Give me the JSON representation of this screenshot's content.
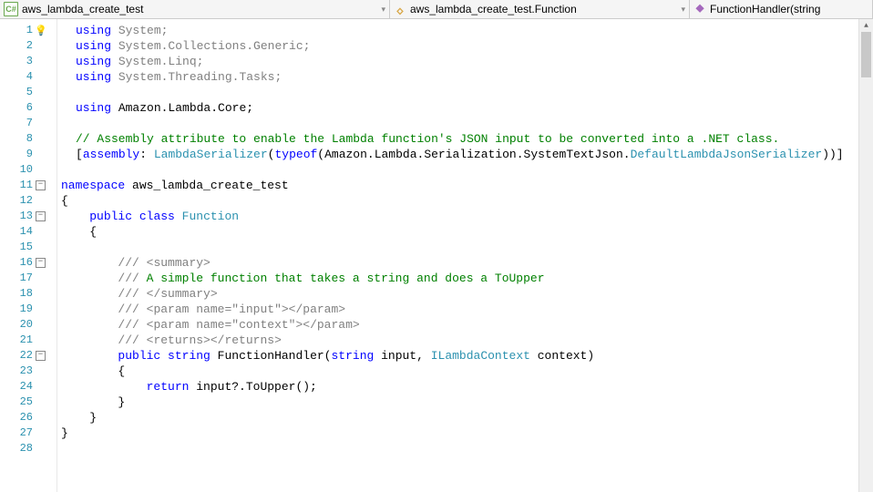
{
  "nav": {
    "crumb1": {
      "icon": "C#",
      "label": "aws_lambda_create_test"
    },
    "crumb2": {
      "label": "aws_lambda_create_test.Function"
    },
    "crumb3": {
      "label": "FunctionHandler(string"
    }
  },
  "lines": {
    "nums": [
      "1",
      "2",
      "3",
      "4",
      "5",
      "6",
      "7",
      "8",
      "9",
      "10",
      "11",
      "12",
      "13",
      "14",
      "15",
      "16",
      "17",
      "18",
      "19",
      "20",
      "21",
      "22",
      "23",
      "24",
      "25",
      "26",
      "27",
      "28"
    ]
  },
  "code": {
    "l1": {
      "a": "using",
      "b": " System;"
    },
    "l2": {
      "a": "using",
      "b": " System.Collections.Generic;"
    },
    "l3": {
      "a": "using",
      "b": " System.Linq;"
    },
    "l4": {
      "a": "using",
      "b": " System.Threading.Tasks;"
    },
    "l5": "",
    "l6": {
      "a": "using",
      "b": " Amazon.Lambda.Core;"
    },
    "l7": "",
    "l8": "// Assembly attribute to enable the Lambda function's JSON input to be converted into a .NET class.",
    "l9": {
      "a": "[",
      "b": "assembly",
      "c": ": ",
      "d": "LambdaSerializer",
      "e": "(",
      "f": "typeof",
      "g": "(Amazon.Lambda.Serialization.SystemTextJson.",
      "h": "DefaultLambdaJsonSerializer",
      "i": "))]"
    },
    "l10": "",
    "l11": {
      "a": "namespace",
      "b": " aws_lambda_create_test"
    },
    "l12": "{",
    "l13": {
      "a": "    ",
      "b": "public",
      "c": " ",
      "d": "class",
      "e": " ",
      "f": "Function"
    },
    "l14": "    {",
    "l15": "",
    "l16": {
      "a": "        ",
      "b": "/// ",
      "c": "<summary>"
    },
    "l17": {
      "a": "        ",
      "b": "/// ",
      "c": "A simple function that takes a string and does a ToUpper"
    },
    "l18": {
      "a": "        ",
      "b": "/// ",
      "c": "</summary>"
    },
    "l19": {
      "a": "        ",
      "b": "/// ",
      "c": "<param name=\"",
      "d": "input",
      "e": "\"></param>"
    },
    "l20": {
      "a": "        ",
      "b": "/// ",
      "c": "<param name=\"",
      "d": "context",
      "e": "\"></param>"
    },
    "l21": {
      "a": "        ",
      "b": "/// ",
      "c": "<returns></returns>"
    },
    "l22": {
      "a": "        ",
      "b": "public",
      "c": " ",
      "d": "string",
      "e": " FunctionHandler(",
      "f": "string",
      "g": " input, ",
      "h": "ILambdaContext",
      "i": " context)"
    },
    "l23": "        {",
    "l24": {
      "a": "            ",
      "b": "return",
      "c": " input?.ToUpper();"
    },
    "l25": "        }",
    "l26": "    }",
    "l27": "}",
    "l28": ""
  },
  "fold": {
    "minus": "−"
  },
  "scroll": {
    "up": "▲",
    "down": "▼",
    "right": "▶",
    "left": "◀"
  },
  "icons": {
    "bulb": "💡",
    "class": "🝔",
    "method": "⯁"
  }
}
